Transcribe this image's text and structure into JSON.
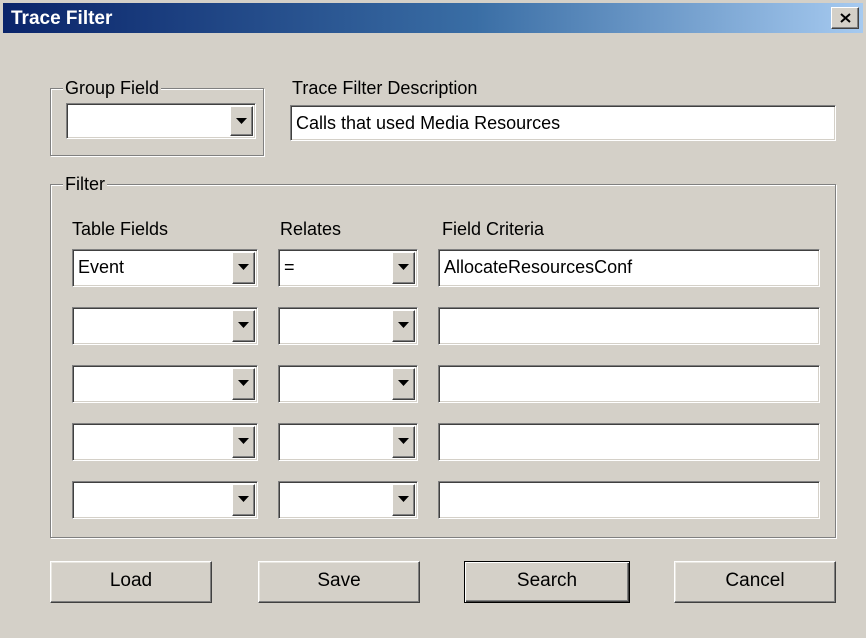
{
  "window": {
    "title": "Trace Filter",
    "close_glyph": "close-icon"
  },
  "group_field": {
    "legend": "Group Field",
    "value": ""
  },
  "description": {
    "label": "Trace Filter Description",
    "value": "Calls that used Media Resources"
  },
  "filter": {
    "legend": "Filter",
    "columns": {
      "table_fields": "Table Fields",
      "relates": "Relates",
      "field_criteria": "Field Criteria"
    },
    "rows": [
      {
        "table_field": "Event",
        "relate": "=",
        "criteria": "AllocateResourcesConf"
      },
      {
        "table_field": "",
        "relate": "",
        "criteria": ""
      },
      {
        "table_field": "",
        "relate": "",
        "criteria": ""
      },
      {
        "table_field": "",
        "relate": "",
        "criteria": ""
      },
      {
        "table_field": "",
        "relate": "",
        "criteria": ""
      }
    ]
  },
  "buttons": {
    "load": "Load",
    "save": "Save",
    "search": "Search",
    "cancel": "Cancel"
  },
  "colors": {
    "face": "#d4d0c8",
    "title_start": "#0a246a",
    "title_end": "#a6caf0"
  }
}
